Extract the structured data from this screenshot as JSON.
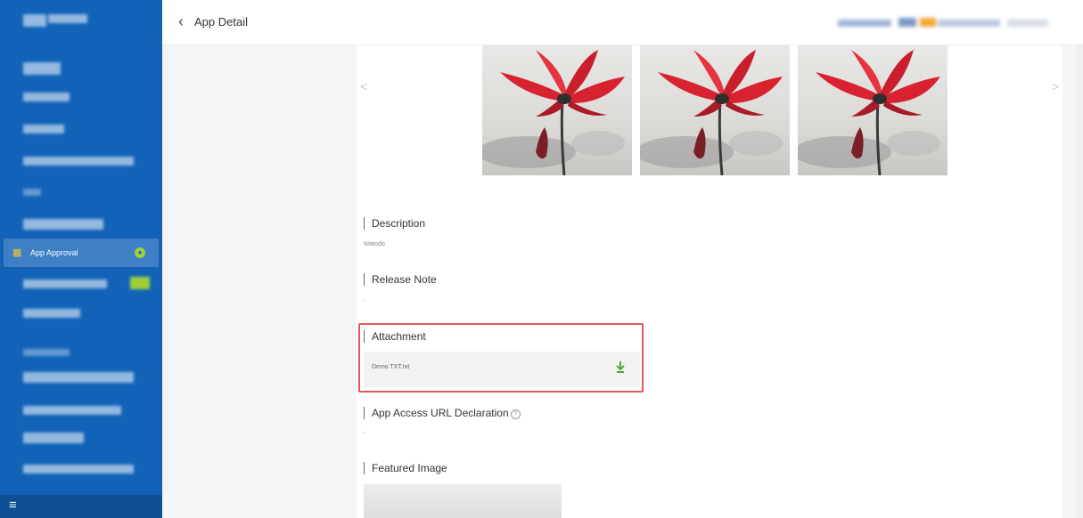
{
  "header": {
    "title": "App Detail"
  },
  "sidebar": {
    "active_item": "App Approval"
  },
  "carousel": {
    "prev": "<",
    "next": ">"
  },
  "sections": {
    "description_title": "Description",
    "description_value": "Watodo",
    "release_note_title": "Release Note",
    "release_note_value": "-",
    "attachment_title": "Attachment",
    "attachment_file": "Demo TXT.txt",
    "access_url_title": "App Access URL Declaration",
    "access_url_value": "-",
    "featured_image_title": "Featured Image"
  },
  "colors": {
    "sidebar": "#1263b8",
    "active_badge": "#9fd039",
    "highlight": "#e05a5a",
    "download": "#5aa33b"
  }
}
